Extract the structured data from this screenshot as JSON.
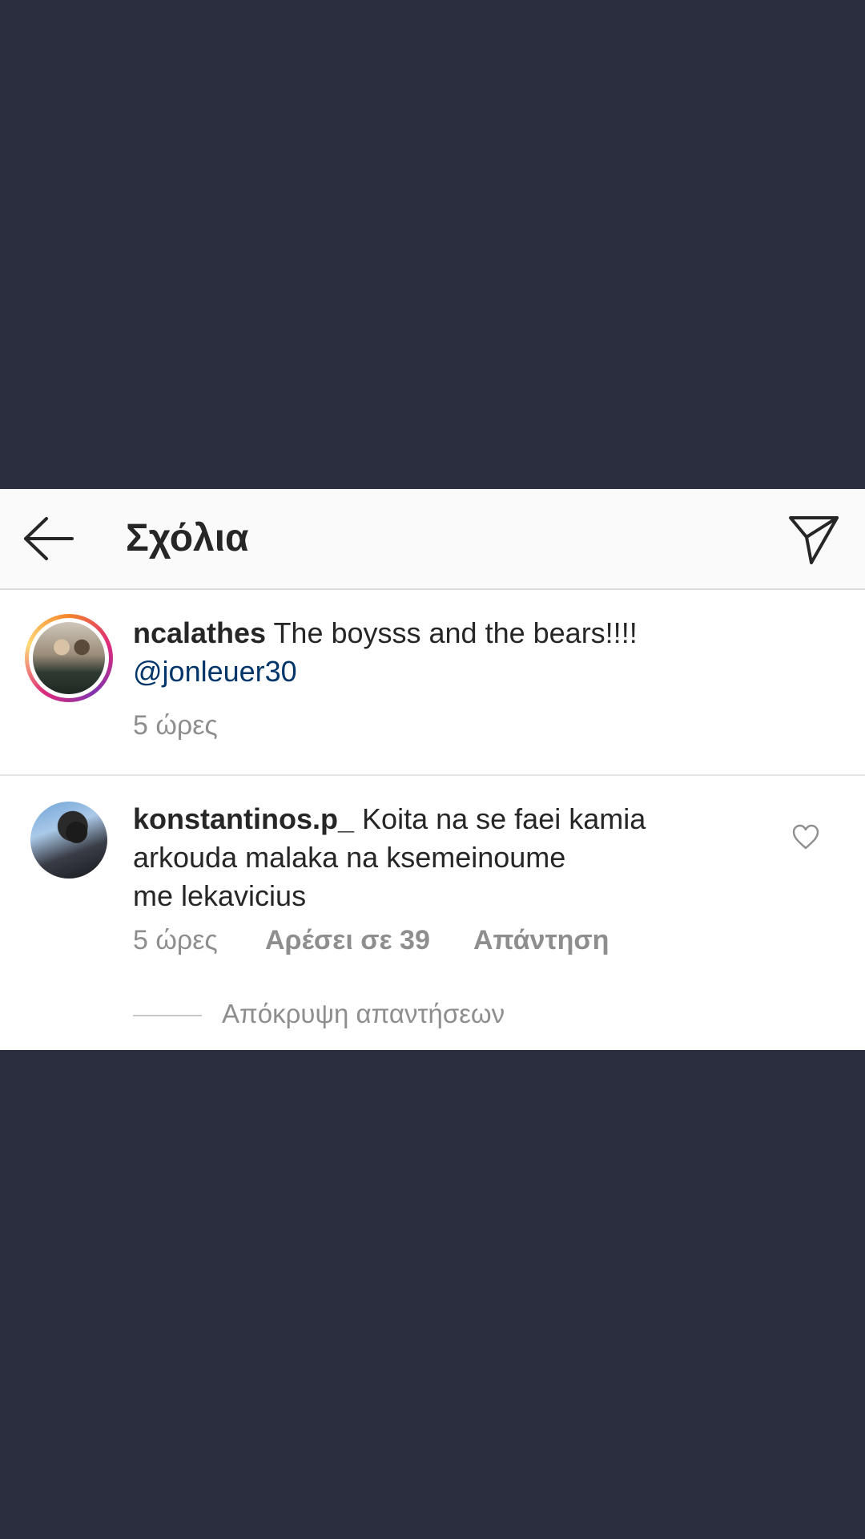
{
  "header": {
    "title": "Σχόλια",
    "back_icon": "arrow-left-icon",
    "share_icon": "paper-plane-icon"
  },
  "caption": {
    "username": "ncalathes",
    "text": "The boysss and the bears!!!!",
    "mention": "@jonleuer30",
    "time": "5 ώρες"
  },
  "comment": {
    "username": "konstantinos.p_",
    "text_line1": "Koita na se faei kamia",
    "text_line2": "arkouda malaka na ksemeinoume",
    "text_line3": "me lekavicius",
    "time": "5 ώρες",
    "likes": "Αρέσει σε 39",
    "reply": "Απάντηση",
    "hide_replies": "Απόκρυψη απαντήσεων"
  },
  "colors": {
    "background": "#2a2e3f",
    "text": "#262626",
    "secondary": "#8e8e8e",
    "mention": "#003569"
  }
}
